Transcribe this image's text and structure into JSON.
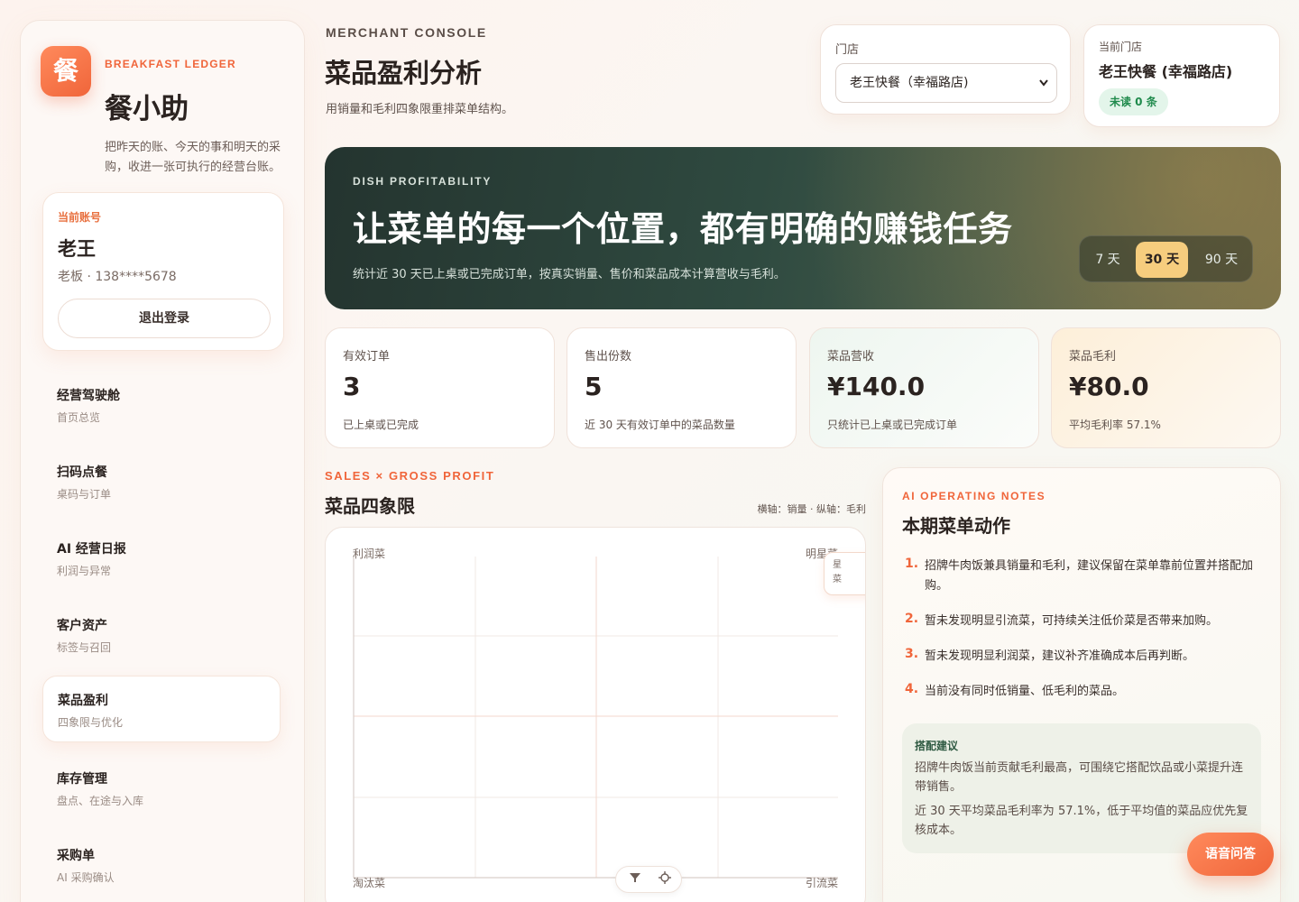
{
  "brand": {
    "logo_char": "餐",
    "eyebrow": "BREAKFAST LEDGER",
    "name": "餐小助",
    "tagline": "把昨天的账、今天的事和明天的采购，收进一张可执行的经营台账。"
  },
  "account": {
    "label": "当前账号",
    "name": "老王",
    "meta": "老板 · 138****5678",
    "logout_label": "退出登录"
  },
  "nav": [
    {
      "title": "经营驾驶舱",
      "sub": "首页总览"
    },
    {
      "title": "扫码点餐",
      "sub": "桌码与订单"
    },
    {
      "title": "AI 经营日报",
      "sub": "利润与异常"
    },
    {
      "title": "客户资产",
      "sub": "标签与召回"
    },
    {
      "title": "菜品盈利",
      "sub": "四象限与优化"
    },
    {
      "title": "库存管理",
      "sub": "盘点、在途与入库"
    },
    {
      "title": "采购单",
      "sub": "AI 采购确认"
    }
  ],
  "nav_active_index": 4,
  "header": {
    "eyebrow": "MERCHANT CONSOLE",
    "title": "菜品盈利分析",
    "subtitle": "用销量和毛利四象限重排菜单结构。"
  },
  "store_picker": {
    "label": "门店",
    "selected": "老王快餐（幸福路店)"
  },
  "current_store": {
    "label": "当前门店",
    "name": "老王快餐 (幸福路店)",
    "badge": "未读 0 条"
  },
  "hero": {
    "eyebrow": "DISH PROFITABILITY",
    "title": "让菜单的每一个位置，都有明确的赚钱任务",
    "subtitle": "统计近 30 天已上桌或已完成订单，按真实销量、售价和菜品成本计算营收与毛利。",
    "ranges": [
      "7 天",
      "30 天",
      "90 天"
    ],
    "active_range": "30 天"
  },
  "kpis": [
    {
      "label": "有效订单",
      "value": "3",
      "note": "已上桌或已完成"
    },
    {
      "label": "售出份数",
      "value": "5",
      "note": "近 30 天有效订单中的菜品数量"
    },
    {
      "label": "菜品营收",
      "value": "¥140.0",
      "note": "只统计已上桌或已完成订单"
    },
    {
      "label": "菜品毛利",
      "value": "¥80.0",
      "note": "平均毛利率 57.1%"
    }
  ],
  "quadrant": {
    "eyebrow": "SALES × GROSS PROFIT",
    "title": "菜品四象限",
    "axis_note": "横轴：销量 · 纵轴：毛利",
    "labels": {
      "top_left": "利润菜",
      "top_right": "明星菜",
      "bottom_left": "淘汰菜",
      "bottom_right": "引流菜"
    },
    "tooltip_text": "星菜"
  },
  "notes": {
    "eyebrow": "AI OPERATING NOTES",
    "title": "本期菜单动作",
    "items": [
      "招牌牛肉饭兼具销量和毛利，建议保留在菜单靠前位置并搭配加购。",
      "暂未发现明显引流菜，可持续关注低价菜是否带来加购。",
      "暂未发现明显利润菜，建议补齐准确成本后再判断。",
      "当前没有同时低销量、低毛利的菜品。"
    ],
    "combo": {
      "title": "搭配建议",
      "lines": [
        "招牌牛肉饭当前贡献毛利最高，可围绕它搭配饮品或小菜提升连带销售。",
        "近 30 天平均菜品毛利率为 57.1%，低于平均值的菜品应优先复核成本。"
      ]
    }
  },
  "voice_button": "语音问答",
  "colors": {
    "accent": "#f0653a",
    "hero_dark": "#24342f",
    "range_active": "#f6cd7e",
    "badge_green": "#1f8a4c"
  }
}
